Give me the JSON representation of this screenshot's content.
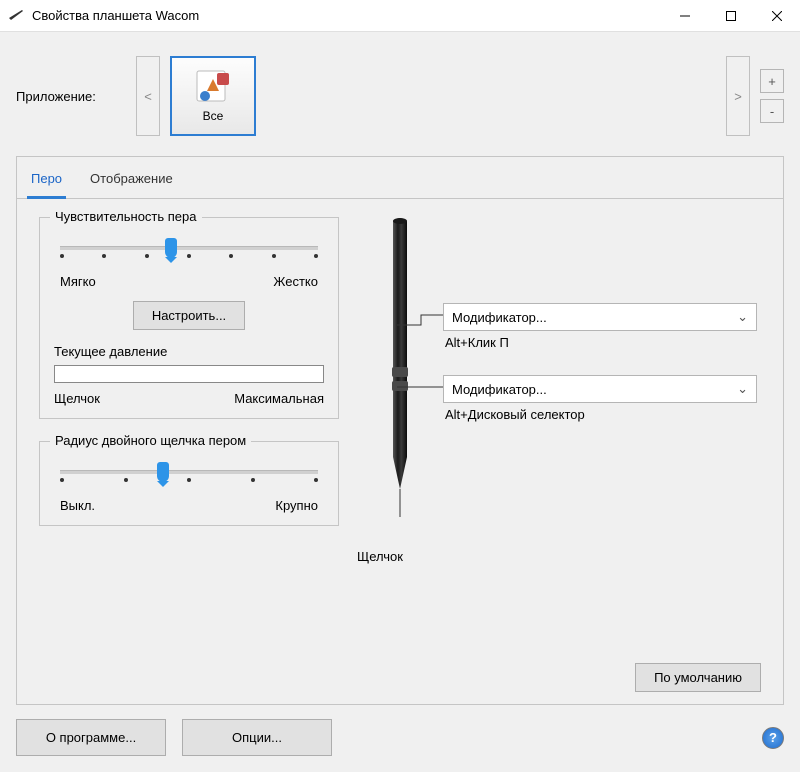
{
  "window": {
    "title": "Свойства планшета Wacom"
  },
  "app_row": {
    "label": "Приложение:",
    "tile_caption": "Все"
  },
  "tabs": {
    "pen": "Перо",
    "mapping": "Отображение"
  },
  "sensitivity": {
    "legend": "Чувствительность пера",
    "soft": "Мягко",
    "hard": "Жестко",
    "tune_btn": "Настроить...",
    "cur_pressure": "Текущее давление",
    "click": "Щелчок",
    "max": "Максимальная",
    "value_pct": 43
  },
  "dblclick": {
    "legend": "Радиус двойного щелчка пером",
    "off": "Выкл.",
    "large": "Крупно",
    "value_pct": 40
  },
  "pen": {
    "button1_dd": "Модификатор...",
    "button1_sub": "Alt+Клик П",
    "button2_dd": "Модификатор...",
    "button2_sub": "Alt+Дисковый селектор",
    "tip": "Щелчок"
  },
  "footer": {
    "default_btn": "По умолчанию"
  },
  "bottom": {
    "about": "О программе...",
    "options": "Опции..."
  }
}
